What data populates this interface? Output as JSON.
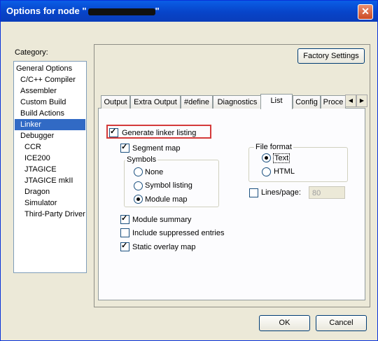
{
  "window": {
    "title": "Options for node \"",
    "title_suffix": "\"",
    "close_glyph": "✕"
  },
  "category": {
    "label": "Category:",
    "items": [
      "General Options",
      "C/C++ Compiler",
      "Assembler",
      "Custom Build",
      "Build Actions",
      "Linker",
      "Debugger",
      "CCR",
      "ICE200",
      "JTAGICE",
      "JTAGICE mkII",
      "Dragon",
      "Simulator",
      "Third-Party Driver"
    ],
    "selected": "Linker"
  },
  "factory_settings_label": "Factory Settings",
  "tabs": [
    "Output",
    "Extra Output",
    "#define",
    "Diagnostics",
    "List",
    "Config",
    "Proce"
  ],
  "active_tab": "List",
  "list_page": {
    "generate_listing": {
      "label": "Generate linker listing",
      "checked": true
    },
    "segment_map": {
      "label": "Segment map",
      "checked": true
    },
    "symbols": {
      "title": "Symbols",
      "options": [
        "None",
        "Symbol listing",
        "Module map"
      ],
      "selected": "Module map"
    },
    "file_format": {
      "title": "File format",
      "options": [
        "Text",
        "HTML"
      ],
      "selected": "Text"
    },
    "lines_per_page": {
      "label": "Lines/page:",
      "checked": false,
      "value": "80"
    },
    "module_summary": {
      "label": "Module summary",
      "checked": true
    },
    "include_suppressed": {
      "label": "Include suppressed entries",
      "checked": false
    },
    "static_overlay": {
      "label": "Static overlay map",
      "checked": true
    }
  },
  "buttons": {
    "ok": "OK",
    "cancel": "Cancel"
  },
  "colors": {
    "titlebar": "#0a5ee6",
    "selection": "#316ac5",
    "highlight_box": "#d43a3a"
  }
}
